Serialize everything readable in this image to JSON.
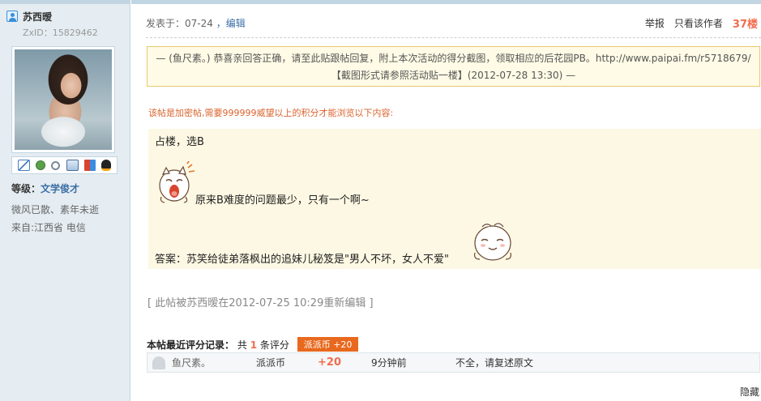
{
  "user": {
    "name": "苏西暧",
    "zxid": "ZxID：15829462",
    "level_label": "等级：",
    "level_value": "文学俊才",
    "signature": "微风已散、素年未逝",
    "from": "来自:江西省 电信"
  },
  "post": {
    "posted_at": "发表于：07-24",
    "edit_link": "，编辑",
    "report": "举报",
    "only_author": "只看该作者",
    "floor": "37楼",
    "quote_text": "— (鱼尺素。) 恭喜亲回答正确，请至此贴跟帖回复，附上本次活动的得分截图，领取相应的后花园PB。http://www.paipai.fm/r5718679/ 【截图形式请参照活动贴一楼】(2012-07-28 13:30) —",
    "locked_notice": "该帖是加密帖,需要999999威望以上的积分才能浏览以下内容:",
    "line1": "占楼，选B",
    "line2": "原来B难度的问题最少，只有一个啊~",
    "line3": "答案：苏笑给徒弟落枫出的追妹儿秘笈是\"男人不坏，女人不爱\"",
    "edited_note": "[ 此帖被苏西暧在2012-07-25 10:29重新编辑 ]"
  },
  "rating": {
    "title": "本帖最近评分记录：",
    "count_prefix": "共",
    "count": "1",
    "count_suffix": "条评分",
    "badge": "派派币 +20",
    "rows": [
      {
        "user": "鱼尺素。",
        "type": "派派币",
        "score": "+20",
        "time": "9分钟前",
        "reason": "不全，请复述原文"
      }
    ]
  },
  "hide_label": "隐藏"
}
